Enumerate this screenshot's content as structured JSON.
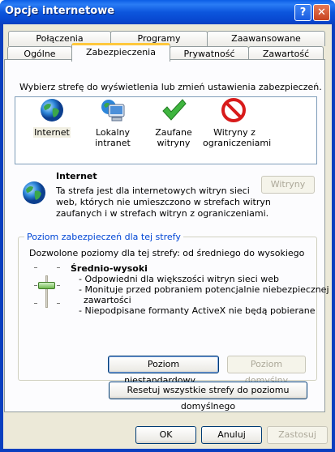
{
  "window": {
    "title": "Opcje internetowe",
    "help_glyph": "?",
    "close_glyph": "✕"
  },
  "tabs": {
    "row1": [
      "Połączenia",
      "Programy",
      "Zaawansowane"
    ],
    "row2": [
      "Ogólne",
      "Zabezpieczenia",
      "Prywatność",
      "Zawartość"
    ]
  },
  "zones": {
    "instruction": "Wybierz strefę do wyświetlenia lub zmień ustawienia zabezpieczeń.",
    "items": [
      {
        "label_line1": "Internet",
        "label_line2": "",
        "icon": "globe-icon"
      },
      {
        "label_line1": "Lokalny",
        "label_line2": "intranet",
        "icon": "computer-icon"
      },
      {
        "label_line1": "Zaufane",
        "label_line2": "witryny",
        "icon": "checkmark-icon"
      },
      {
        "label_line1": "Witryny z",
        "label_line2": "ograniczeniami",
        "icon": "prohibited-icon"
      }
    ]
  },
  "selected_zone": {
    "name": "Internet",
    "desc_line1": "Ta strefa jest dla internetowych witryn sieci",
    "desc_line2": "web, których nie umieszczono w strefach witryn",
    "desc_line3": "zaufanych i w strefach witryn z ograniczeniami.",
    "sites_button": "Witryny"
  },
  "security_level": {
    "group_title": "Poziom zabezpieczeń dla tej strefy",
    "allowed": "Dozwolone poziomy dla tej strefy: od średniego do wysokiego",
    "level_name": "Średnio-wysoki",
    "bullet1": "- Odpowiedni dla większości witryn sieci web",
    "bullet2a": "- Monituje przed pobraniem potencjalnie niebezpiecznej",
    "bullet2b": "zawartości",
    "bullet3": "- Niepodpisane formanty ActiveX nie będą pobierane",
    "custom_button": "Poziom niestandardowy...",
    "default_button": "Poziom domyślny",
    "reset_button": "Resetuj wszystkie strefy do poziomu domyślnego"
  },
  "footer": {
    "ok": "OK",
    "cancel": "Anuluj",
    "apply": "Zastosuj"
  },
  "colors": {
    "title_bar": "#0a54e0",
    "accent_tab": "#ffc83c",
    "group_title": "#0046d5"
  }
}
